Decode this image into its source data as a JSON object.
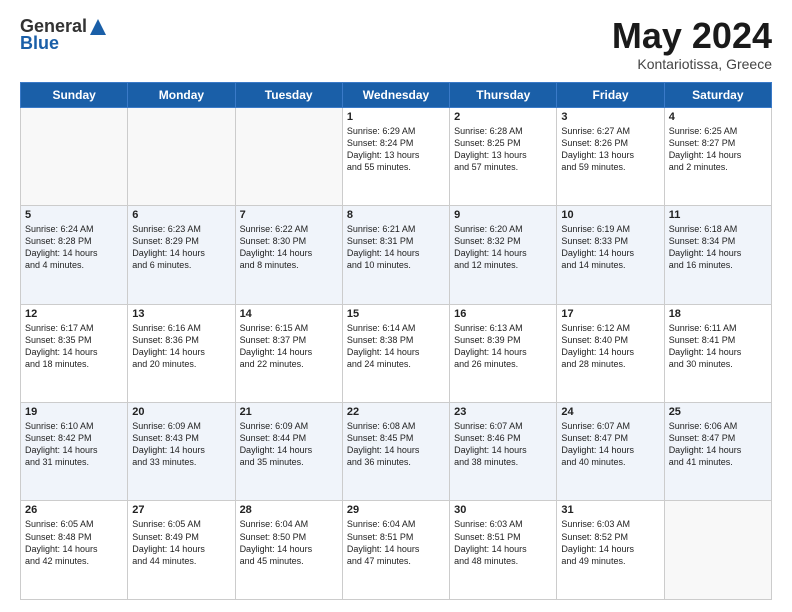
{
  "header": {
    "logo_general": "General",
    "logo_blue": "Blue",
    "title": "May 2024",
    "location": "Kontariotissa, Greece"
  },
  "days_of_week": [
    "Sunday",
    "Monday",
    "Tuesday",
    "Wednesday",
    "Thursday",
    "Friday",
    "Saturday"
  ],
  "weeks": [
    [
      {
        "day": "",
        "info": ""
      },
      {
        "day": "",
        "info": ""
      },
      {
        "day": "",
        "info": ""
      },
      {
        "day": "1",
        "info": "Sunrise: 6:29 AM\nSunset: 8:24 PM\nDaylight: 13 hours\nand 55 minutes."
      },
      {
        "day": "2",
        "info": "Sunrise: 6:28 AM\nSunset: 8:25 PM\nDaylight: 13 hours\nand 57 minutes."
      },
      {
        "day": "3",
        "info": "Sunrise: 6:27 AM\nSunset: 8:26 PM\nDaylight: 13 hours\nand 59 minutes."
      },
      {
        "day": "4",
        "info": "Sunrise: 6:25 AM\nSunset: 8:27 PM\nDaylight: 14 hours\nand 2 minutes."
      }
    ],
    [
      {
        "day": "5",
        "info": "Sunrise: 6:24 AM\nSunset: 8:28 PM\nDaylight: 14 hours\nand 4 minutes."
      },
      {
        "day": "6",
        "info": "Sunrise: 6:23 AM\nSunset: 8:29 PM\nDaylight: 14 hours\nand 6 minutes."
      },
      {
        "day": "7",
        "info": "Sunrise: 6:22 AM\nSunset: 8:30 PM\nDaylight: 14 hours\nand 8 minutes."
      },
      {
        "day": "8",
        "info": "Sunrise: 6:21 AM\nSunset: 8:31 PM\nDaylight: 14 hours\nand 10 minutes."
      },
      {
        "day": "9",
        "info": "Sunrise: 6:20 AM\nSunset: 8:32 PM\nDaylight: 14 hours\nand 12 minutes."
      },
      {
        "day": "10",
        "info": "Sunrise: 6:19 AM\nSunset: 8:33 PM\nDaylight: 14 hours\nand 14 minutes."
      },
      {
        "day": "11",
        "info": "Sunrise: 6:18 AM\nSunset: 8:34 PM\nDaylight: 14 hours\nand 16 minutes."
      }
    ],
    [
      {
        "day": "12",
        "info": "Sunrise: 6:17 AM\nSunset: 8:35 PM\nDaylight: 14 hours\nand 18 minutes."
      },
      {
        "day": "13",
        "info": "Sunrise: 6:16 AM\nSunset: 8:36 PM\nDaylight: 14 hours\nand 20 minutes."
      },
      {
        "day": "14",
        "info": "Sunrise: 6:15 AM\nSunset: 8:37 PM\nDaylight: 14 hours\nand 22 minutes."
      },
      {
        "day": "15",
        "info": "Sunrise: 6:14 AM\nSunset: 8:38 PM\nDaylight: 14 hours\nand 24 minutes."
      },
      {
        "day": "16",
        "info": "Sunrise: 6:13 AM\nSunset: 8:39 PM\nDaylight: 14 hours\nand 26 minutes."
      },
      {
        "day": "17",
        "info": "Sunrise: 6:12 AM\nSunset: 8:40 PM\nDaylight: 14 hours\nand 28 minutes."
      },
      {
        "day": "18",
        "info": "Sunrise: 6:11 AM\nSunset: 8:41 PM\nDaylight: 14 hours\nand 30 minutes."
      }
    ],
    [
      {
        "day": "19",
        "info": "Sunrise: 6:10 AM\nSunset: 8:42 PM\nDaylight: 14 hours\nand 31 minutes."
      },
      {
        "day": "20",
        "info": "Sunrise: 6:09 AM\nSunset: 8:43 PM\nDaylight: 14 hours\nand 33 minutes."
      },
      {
        "day": "21",
        "info": "Sunrise: 6:09 AM\nSunset: 8:44 PM\nDaylight: 14 hours\nand 35 minutes."
      },
      {
        "day": "22",
        "info": "Sunrise: 6:08 AM\nSunset: 8:45 PM\nDaylight: 14 hours\nand 36 minutes."
      },
      {
        "day": "23",
        "info": "Sunrise: 6:07 AM\nSunset: 8:46 PM\nDaylight: 14 hours\nand 38 minutes."
      },
      {
        "day": "24",
        "info": "Sunrise: 6:07 AM\nSunset: 8:47 PM\nDaylight: 14 hours\nand 40 minutes."
      },
      {
        "day": "25",
        "info": "Sunrise: 6:06 AM\nSunset: 8:47 PM\nDaylight: 14 hours\nand 41 minutes."
      }
    ],
    [
      {
        "day": "26",
        "info": "Sunrise: 6:05 AM\nSunset: 8:48 PM\nDaylight: 14 hours\nand 42 minutes."
      },
      {
        "day": "27",
        "info": "Sunrise: 6:05 AM\nSunset: 8:49 PM\nDaylight: 14 hours\nand 44 minutes."
      },
      {
        "day": "28",
        "info": "Sunrise: 6:04 AM\nSunset: 8:50 PM\nDaylight: 14 hours\nand 45 minutes."
      },
      {
        "day": "29",
        "info": "Sunrise: 6:04 AM\nSunset: 8:51 PM\nDaylight: 14 hours\nand 47 minutes."
      },
      {
        "day": "30",
        "info": "Sunrise: 6:03 AM\nSunset: 8:51 PM\nDaylight: 14 hours\nand 48 minutes."
      },
      {
        "day": "31",
        "info": "Sunrise: 6:03 AM\nSunset: 8:52 PM\nDaylight: 14 hours\nand 49 minutes."
      },
      {
        "day": "",
        "info": ""
      }
    ]
  ]
}
